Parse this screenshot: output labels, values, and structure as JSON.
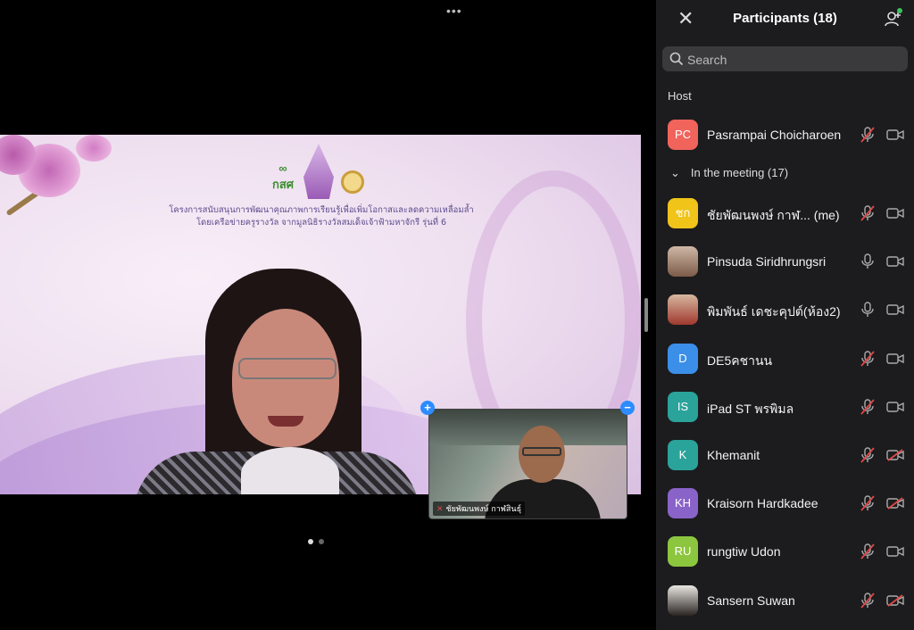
{
  "meeting": {
    "more_options": "•••",
    "presentation": {
      "banner_line1": "โครงการสนับสนุนการพัฒนาคุณภาพการเรียนรู้เพื่อเพิ่มโอกาสและลดความเหลื่อมล้ำ",
      "banner_line2": "โดยเครือข่ายครูรางวัล จากมูลนิธิรางวัลสมเด็จเจ้าฟ้ามหาจักรี รุ่นที่ 6",
      "logo_text": "กสศ"
    },
    "self_view": {
      "label": "ชัยพัฒนพงษ์  กาฬสินธุ์",
      "add_icon": "+",
      "remove_icon": "−"
    },
    "pages": {
      "current": 1,
      "total": 2
    }
  },
  "panel": {
    "title": "Participants (18)",
    "search_placeholder": "Search",
    "host_section": "Host",
    "meeting_section": "In the meeting (17)",
    "colors": {
      "background": "#1c1c1e",
      "muted_red": "#e04747",
      "online_green": "#39c25a"
    },
    "host": {
      "initials": "PC",
      "name": "Pasrampai Choicharoen",
      "avatar_color": "#f0645c",
      "mic_muted": true,
      "video_off": false
    },
    "participants": [
      {
        "initials": "ชก",
        "name": "ชัยพัฒนพงษ์  กาฬ...  (me)",
        "avatar_color": "#f0c419",
        "photo": false,
        "mic_muted": true,
        "video_off": false
      },
      {
        "initials": "",
        "name": "Pinsuda Siridhrungsri",
        "avatar_color": "",
        "photo": true,
        "mic_muted": false,
        "video_off": false
      },
      {
        "initials": "",
        "name": "พิมพันธ์ เดชะคุปต์(ห้อง2)",
        "avatar_color": "",
        "photo": true,
        "mic_muted": false,
        "video_off": false
      },
      {
        "initials": "D",
        "name": "DE5คชานน",
        "avatar_color": "#3b8fe8",
        "photo": false,
        "mic_muted": true,
        "video_off": false
      },
      {
        "initials": "IS",
        "name": "iPad ST  พรพิมล",
        "avatar_color": "#2aa39a",
        "photo": false,
        "mic_muted": true,
        "video_off": false
      },
      {
        "initials": "K",
        "name": "Khemanit",
        "avatar_color": "#2aa39a",
        "photo": false,
        "mic_muted": true,
        "video_off": true
      },
      {
        "initials": "KH",
        "name": "Kraisorn Hardkadee",
        "avatar_color": "#8a63c9",
        "photo": false,
        "mic_muted": true,
        "video_off": true
      },
      {
        "initials": "RU",
        "name": "rungtiw Udon",
        "avatar_color": "#8cc63e",
        "photo": false,
        "mic_muted": true,
        "video_off": false
      },
      {
        "initials": "",
        "name": "Sansern Suwan",
        "avatar_color": "",
        "photo": true,
        "mic_muted": true,
        "video_off": true
      }
    ]
  }
}
